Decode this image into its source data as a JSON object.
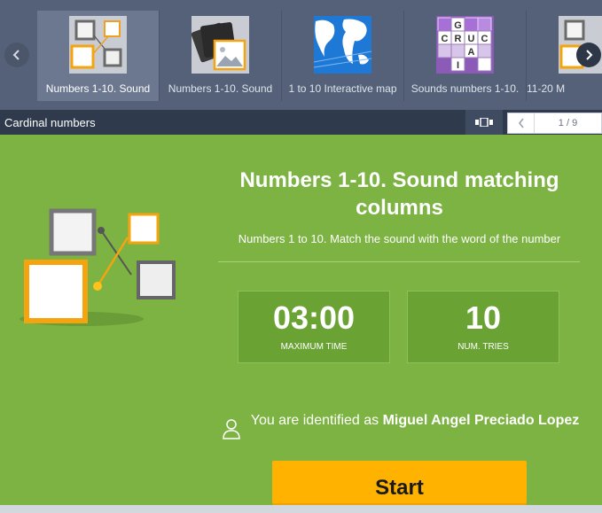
{
  "carousel": {
    "items": [
      {
        "label": "Numbers 1-10. Sound",
        "thumb": "matching-icon",
        "active": true
      },
      {
        "label": "Numbers 1-10. Sound",
        "thumb": "image-cards-icon",
        "active": false
      },
      {
        "label": "1 to 10 Interactive map",
        "thumb": "world-map-icon",
        "active": false
      },
      {
        "label": "Sounds numbers 1-10.",
        "thumb": "crossword-icon",
        "active": false
      },
      {
        "label": "11-20 M",
        "thumb": "matching-icon",
        "active": false
      }
    ],
    "crossword_letters": [
      "G",
      "C",
      "R",
      "U",
      "C",
      "A",
      "I"
    ]
  },
  "titlebar": {
    "title": "Cardinal numbers",
    "pager": "1 / 9"
  },
  "game": {
    "title": "Numbers 1-10. Sound matching columns",
    "description": "Numbers 1 to 10. Match the sound with the word of the number",
    "stats": [
      {
        "value": "03:00",
        "label": "MAXIMUM TIME"
      },
      {
        "value": "10",
        "label": "NUM. TRIES"
      }
    ],
    "identity_prefix": "You are identified as",
    "user_name": "Miguel Angel Preciado Lopez",
    "start_label": "Start"
  },
  "colors": {
    "accent_green": "#7cb342",
    "start_button": "#ffb300",
    "carousel_bg": "#546178",
    "titlebar_bg": "#2f3a4c"
  }
}
